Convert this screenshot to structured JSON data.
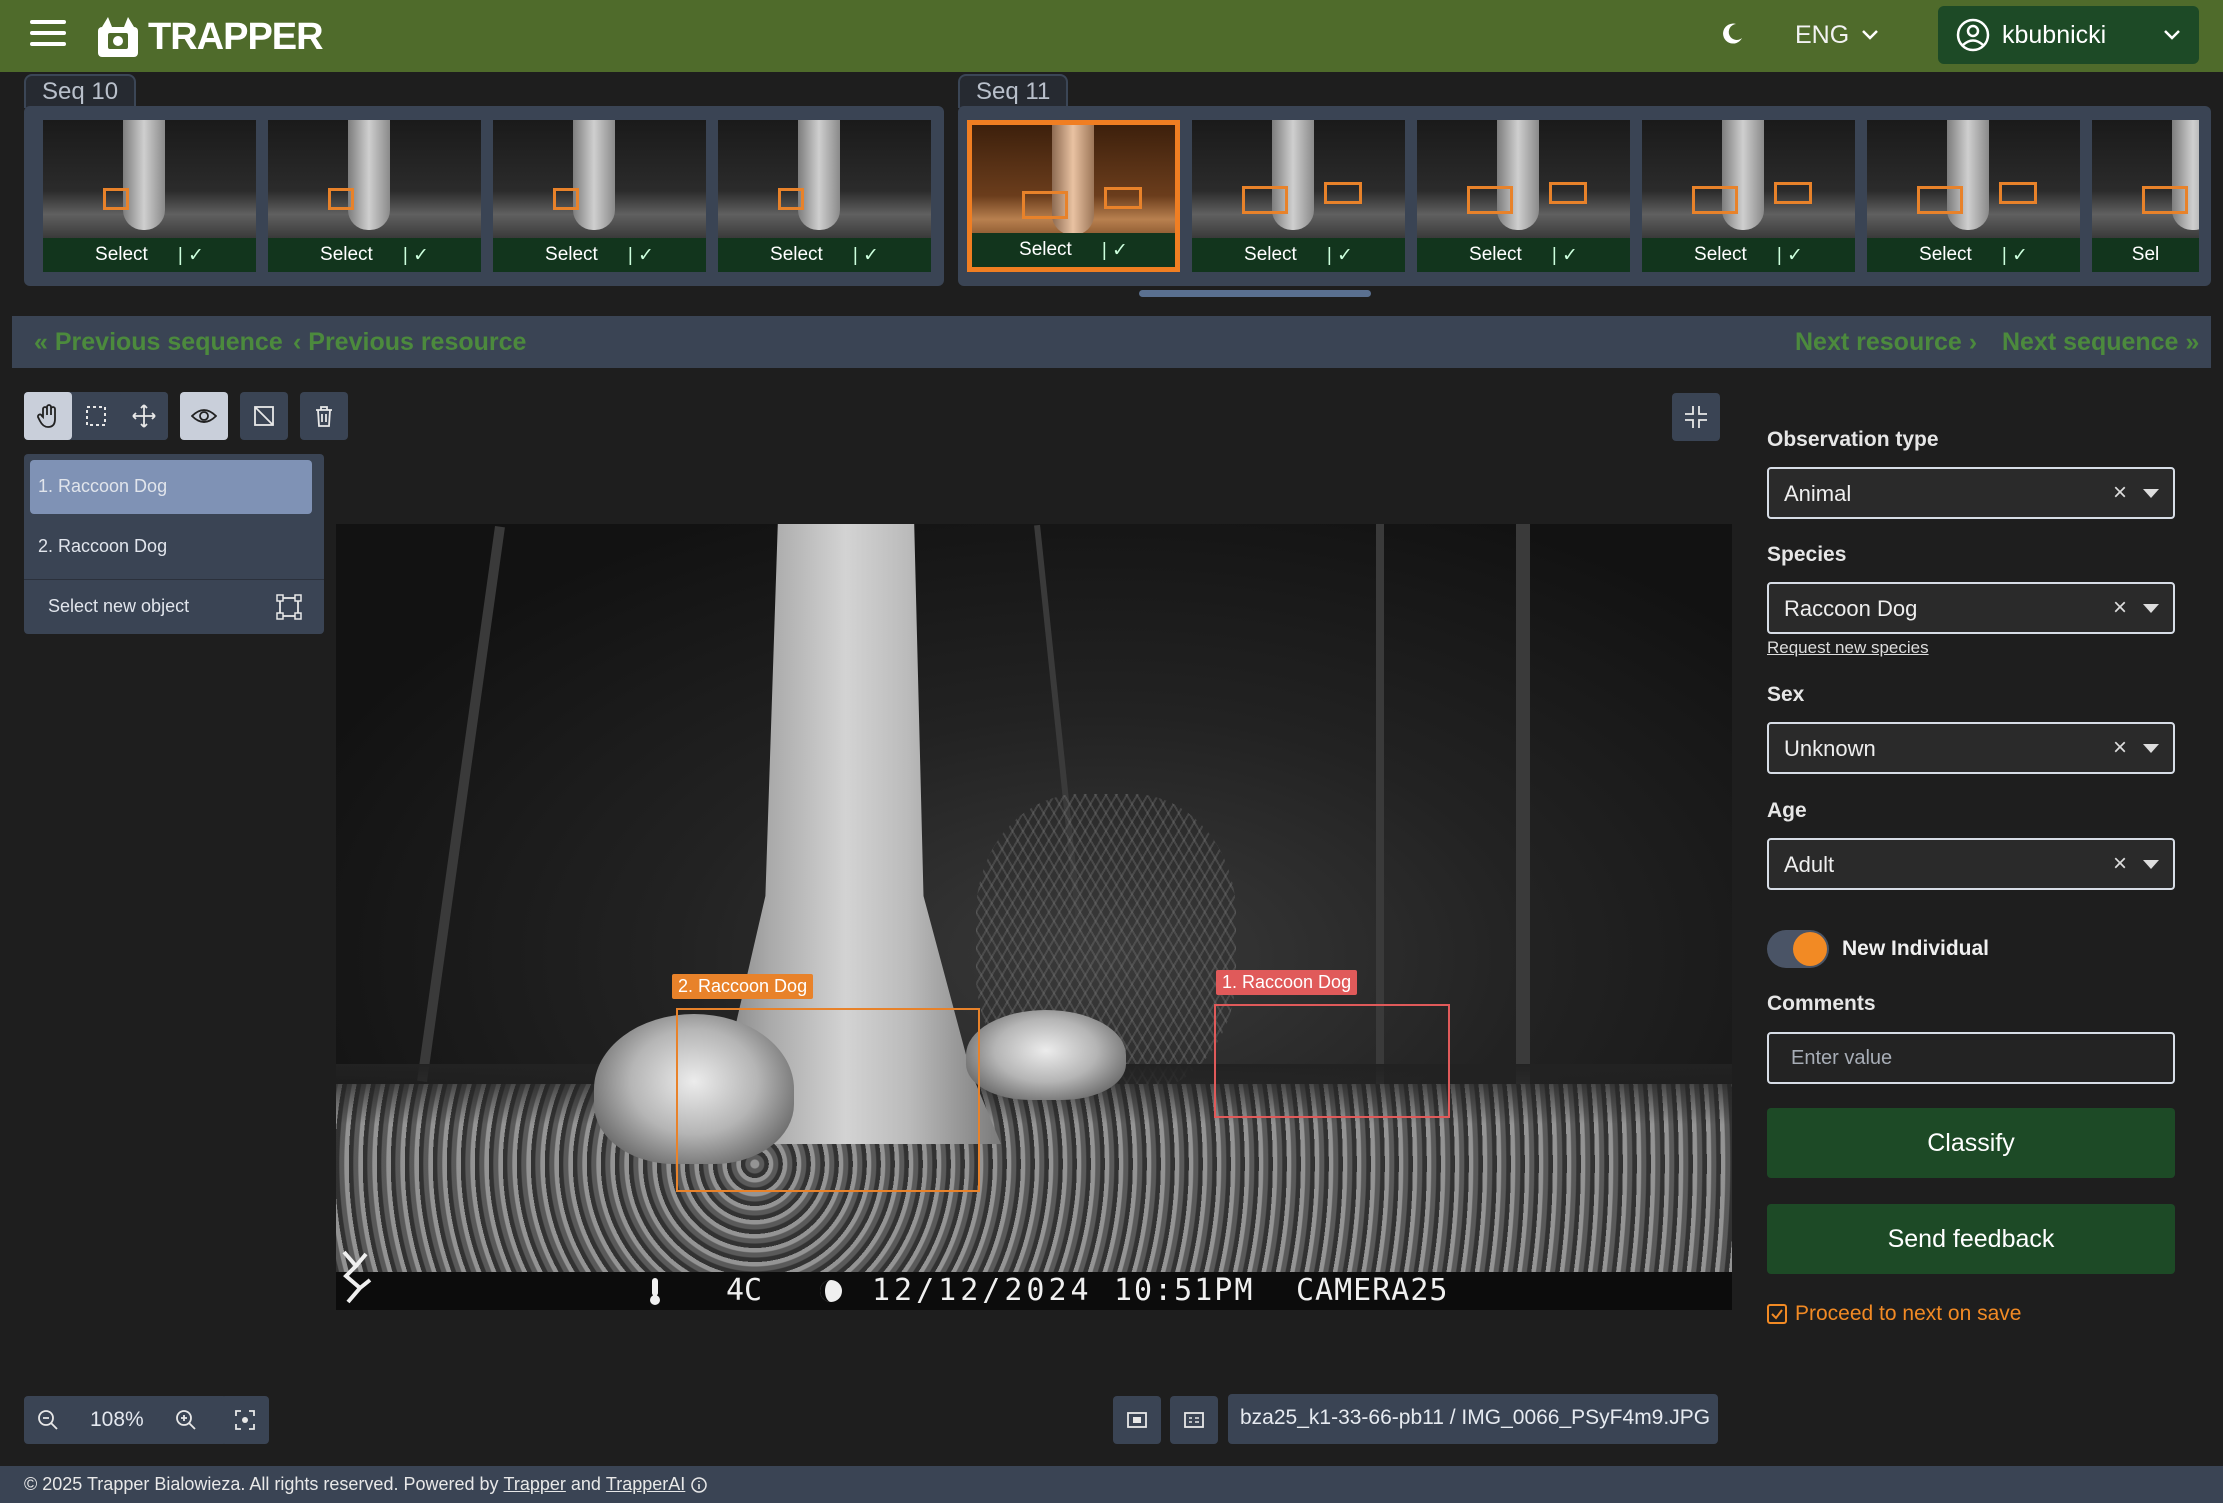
{
  "app": {
    "logo_text": "TRAPPER",
    "language": "ENG",
    "user": "kbubnicki"
  },
  "sequences": [
    {
      "label": "Seq 10",
      "thumbs": [
        {
          "select_label": "Select",
          "active": false
        },
        {
          "select_label": "Select",
          "active": false
        },
        {
          "select_label": "Select",
          "active": false
        },
        {
          "select_label": "Select",
          "active": false
        }
      ]
    },
    {
      "label": "Seq 11",
      "thumbs": [
        {
          "select_label": "Select",
          "active": true
        },
        {
          "select_label": "Select",
          "active": false
        },
        {
          "select_label": "Select",
          "active": false
        },
        {
          "select_label": "Select",
          "active": false
        },
        {
          "select_label": "Select",
          "active": false
        },
        {
          "select_label": "Sel",
          "active": false
        }
      ]
    }
  ],
  "nav": {
    "prev_sequence": "Previous sequence",
    "prev_resource": "Previous resource",
    "next_resource": "Next resource",
    "next_sequence": "Next sequence"
  },
  "objects": {
    "items": [
      "1. Raccoon Dog",
      "2. Raccoon Dog"
    ],
    "selected_index": 0,
    "new_object_label": "Select new object"
  },
  "image": {
    "annotations": [
      {
        "label": "1. Raccoon Dog",
        "color": "#e05a5a"
      },
      {
        "label": "2. Raccoon Dog",
        "color": "#e8822a"
      }
    ],
    "stamp": {
      "temperature": "4C",
      "date": "12/12/2024",
      "time": "10:51PM",
      "camera": "CAMERA25"
    },
    "filename": "bza25_k1-33-66-pb11 / IMG_0066_PSyF4m9.JPG",
    "zoom": "108%"
  },
  "form": {
    "observation_type": {
      "label": "Observation type",
      "value": "Animal"
    },
    "species": {
      "label": "Species",
      "value": "Raccoon Dog",
      "request_link": "Request new species"
    },
    "sex": {
      "label": "Sex",
      "value": "Unknown"
    },
    "age": {
      "label": "Age",
      "value": "Adult"
    },
    "new_individual": {
      "label": "New Individual",
      "checked": true
    },
    "comments": {
      "label": "Comments",
      "placeholder": "Enter value"
    },
    "classify": "Classify",
    "send_feedback": "Send feedback",
    "proceed_next": "Proceed to next on save"
  },
  "footer": {
    "prefix": "© 2025 Trapper Bialowieza. All rights reserved. Powered by",
    "link1": "Trapper",
    "and": "and",
    "link2": "TrapperAI"
  },
  "colors": {
    "topbar": "#4f6b2b",
    "primary_button": "#1d4a26",
    "accent": "#f28a24",
    "nav_link": "#4c8a3d",
    "panel": "#3a4454"
  }
}
